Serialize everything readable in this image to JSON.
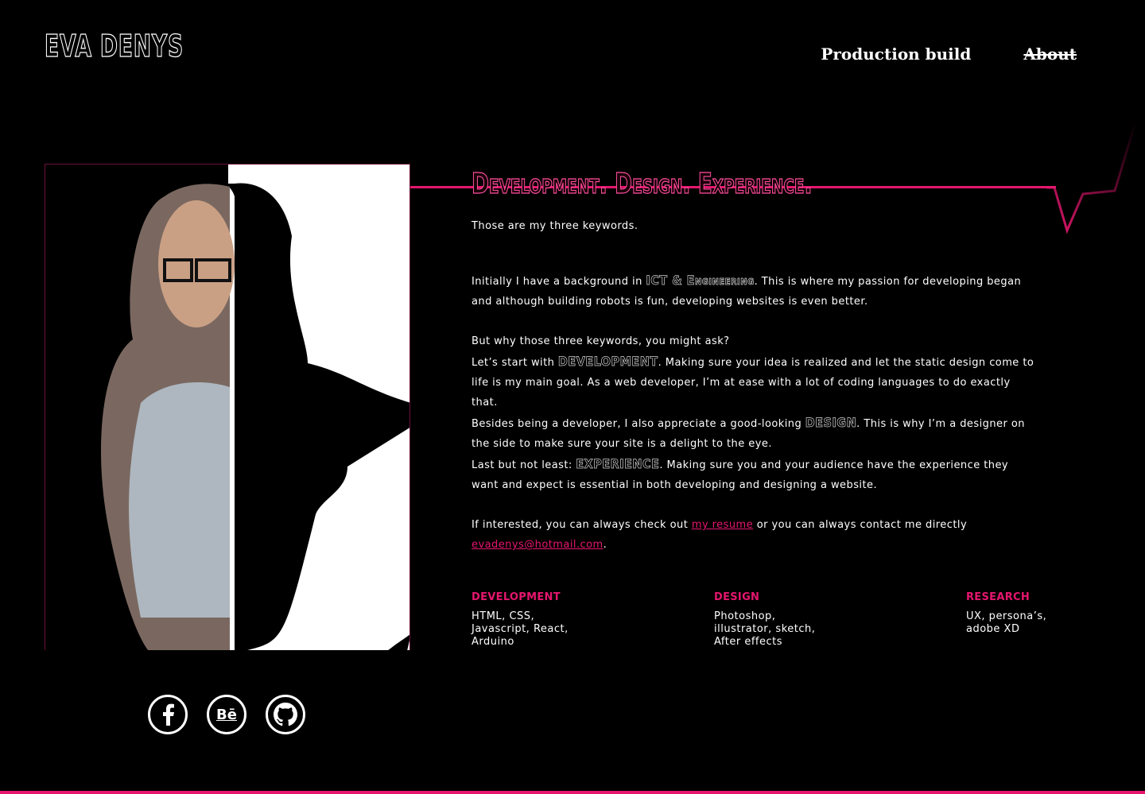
{
  "header": {
    "logo": "EVA DENYS",
    "nav": [
      {
        "label": "Production build"
      },
      {
        "label": "About"
      }
    ]
  },
  "about": {
    "headline": "Development. Design. Experience.",
    "intro": "Those are my three keywords.",
    "p2_pre": "Initially I have a background in ",
    "p2_kw": "ICT & Engineering",
    "p2_post": ". This is where my passion for developing began and although building robots is fun, developing websites is even better.",
    "p3_line1": "But why those three keywords, you might ask?",
    "p3_dev_pre": "Let’s start with ",
    "p3_dev_kw": "DEVELOPMENT",
    "p3_dev_post": ". Making sure your idea is realized and let the static design come to life is my main goal. As a web developer, I’m at ease with a lot of coding languages to do exactly that.",
    "p3_design_pre": "Besides being a developer, I also appreciate a good-looking ",
    "p3_design_kw": "DESIGN",
    "p3_design_post": ". This is why I’m a designer on the side to make sure your site is a delight to the eye.",
    "p3_exp_pre": "Last but not least: ",
    "p3_exp_kw": "EXPERIENCE",
    "p3_exp_post": ". Making sure you and your audience have the experience they want and expect is essential in both developing and designing a website.",
    "p4_pre": "If interested, you can always check out ",
    "p4_link1": "my resume",
    "p4_mid": " or you can always contact me directly ",
    "p4_link2": "evadenys@hotmail.com",
    "p4_post": "."
  },
  "skills": [
    {
      "title": "DEVELOPMENT",
      "items": [
        "HTML, CSS,",
        "Javascript, React,",
        "Arduino"
      ]
    },
    {
      "title": "DESIGN",
      "items": [
        "Photoshop,",
        "illustrator, sketch,",
        "After effects"
      ]
    },
    {
      "title": "RESEARCH",
      "items": [
        "UX, persona’s,",
        "adobe XD"
      ]
    }
  ],
  "socials": {
    "behance_text": "Bē",
    "icons": [
      "facebook-icon",
      "behance-icon",
      "github-icon"
    ]
  },
  "colors": {
    "accent": "#e5166e",
    "background": "#000000",
    "text": "#ffffff"
  }
}
